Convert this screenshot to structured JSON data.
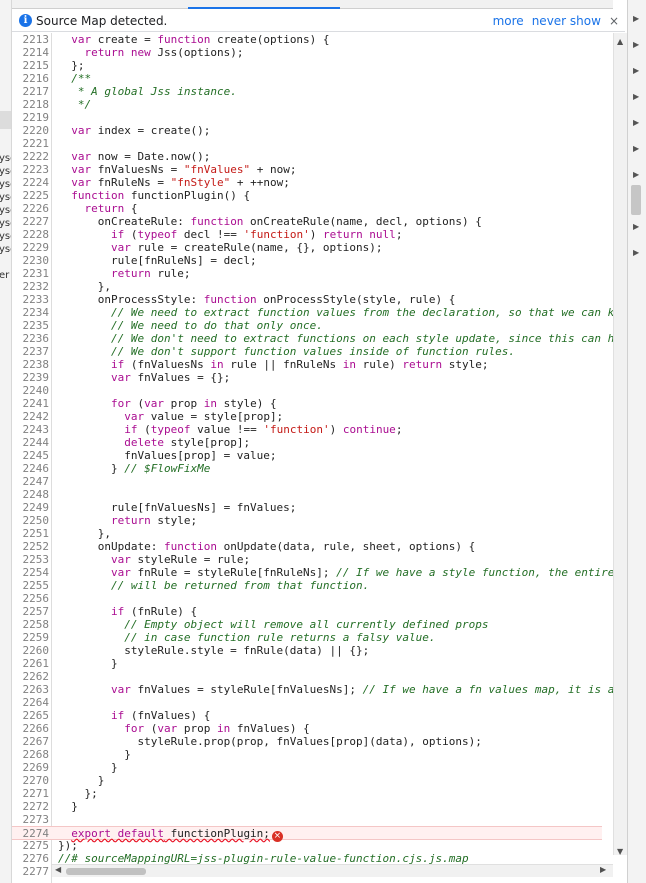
{
  "infobar": {
    "icon": "info-icon",
    "message": "Source Map detected.",
    "more_link": "more",
    "never_show_link": "never show",
    "close_glyph": "×"
  },
  "left_strip": {
    "fragments": [
      "yso",
      "yso",
      "yso",
      "yso",
      "yso",
      "yso",
      "yso",
      "yso",
      "er"
    ]
  },
  "editor": {
    "lines": [
      {
        "n": "2213",
        "html": "  <span class=\"k\">var</span> create = <span class=\"k\">function</span> create(options) {"
      },
      {
        "n": "2214",
        "html": "    <span class=\"k\">return new</span> Jss(options);"
      },
      {
        "n": "2215",
        "html": "  };"
      },
      {
        "n": "2216",
        "html": "  <span class=\"c\">/**</span>"
      },
      {
        "n": "2217",
        "html": "  <span class=\"c\"> * A global Jss instance.</span>"
      },
      {
        "n": "2218",
        "html": "  <span class=\"c\"> */</span>"
      },
      {
        "n": "2219",
        "html": ""
      },
      {
        "n": "2220",
        "html": "  <span class=\"k\">var</span> index = create();"
      },
      {
        "n": "2221",
        "html": ""
      },
      {
        "n": "2222",
        "html": "  <span class=\"k\">var</span> now = Date.now();"
      },
      {
        "n": "2223",
        "html": "  <span class=\"k\">var</span> fnValuesNs = <span class=\"s\">\"fnValues\"</span> + now;"
      },
      {
        "n": "2224",
        "html": "  <span class=\"k\">var</span> fnRuleNs = <span class=\"s\">\"fnStyle\"</span> + ++now;"
      },
      {
        "n": "2225",
        "html": "  <span class=\"k\">function</span> functionPlugin() {"
      },
      {
        "n": "2226",
        "html": "    <span class=\"k\">return</span> {"
      },
      {
        "n": "2227",
        "html": "      onCreateRule: <span class=\"k\">function</span> onCreateRule(name, decl, options) {"
      },
      {
        "n": "2228",
        "html": "        <span class=\"k\">if</span> (<span class=\"k\">typeof</span> decl !== <span class=\"s\">'function'</span>) <span class=\"k\">return null</span>;"
      },
      {
        "n": "2229",
        "html": "        <span class=\"k\">var</span> rule = createRule(name, {}, options);"
      },
      {
        "n": "2230",
        "html": "        rule[fnRuleNs] = decl;"
      },
      {
        "n": "2231",
        "html": "        <span class=\"k\">return</span> rule;"
      },
      {
        "n": "2232",
        "html": "      },"
      },
      {
        "n": "2233",
        "html": "      onProcessStyle: <span class=\"k\">function</span> onProcessStyle(style, rule) {"
      },
      {
        "n": "2234",
        "html": "        <span class=\"c\">// We need to extract function values from the declaration, so that we can k</span>"
      },
      {
        "n": "2235",
        "html": "        <span class=\"c\">// We need to do that only once.</span>"
      },
      {
        "n": "2236",
        "html": "        <span class=\"c\">// We don't need to extract functions on each style update, since this can h</span>"
      },
      {
        "n": "2237",
        "html": "        <span class=\"c\">// We don't support function values inside of function rules.</span>"
      },
      {
        "n": "2238",
        "html": "        <span class=\"k\">if</span> (fnValuesNs <span class=\"k\">in</span> rule || fnRuleNs <span class=\"k\">in</span> rule) <span class=\"k\">return</span> style;"
      },
      {
        "n": "2239",
        "html": "        <span class=\"k\">var</span> fnValues = {};"
      },
      {
        "n": "2240",
        "html": ""
      },
      {
        "n": "2241",
        "html": "        <span class=\"k\">for</span> (<span class=\"k\">var</span> prop <span class=\"k\">in</span> style) {"
      },
      {
        "n": "2242",
        "html": "          <span class=\"k\">var</span> value = style[prop];"
      },
      {
        "n": "2243",
        "html": "          <span class=\"k\">if</span> (<span class=\"k\">typeof</span> value !== <span class=\"s\">'function'</span>) <span class=\"k\">continue</span>;"
      },
      {
        "n": "2244",
        "html": "          <span class=\"k\">delete</span> style[prop];"
      },
      {
        "n": "2245",
        "html": "          fnValues[prop] = value;"
      },
      {
        "n": "2246",
        "html": "        } <span class=\"c\">// $FlowFixMe</span>"
      },
      {
        "n": "2247",
        "html": ""
      },
      {
        "n": "2248",
        "html": ""
      },
      {
        "n": "2249",
        "html": "        rule[fnValuesNs] = fnValues;"
      },
      {
        "n": "2250",
        "html": "        <span class=\"k\">return</span> style;"
      },
      {
        "n": "2251",
        "html": "      },"
      },
      {
        "n": "2252",
        "html": "      onUpdate: <span class=\"k\">function</span> onUpdate(data, rule, sheet, options) {"
      },
      {
        "n": "2253",
        "html": "        <span class=\"k\">var</span> styleRule = rule;"
      },
      {
        "n": "2254",
        "html": "        <span class=\"k\">var</span> fnRule = styleRule[fnRuleNs]; <span class=\"c\">// If we have a style function, the entire</span>"
      },
      {
        "n": "2255",
        "html": "        <span class=\"c\">// will be returned from that function.</span>"
      },
      {
        "n": "2256",
        "html": ""
      },
      {
        "n": "2257",
        "html": "        <span class=\"k\">if</span> (fnRule) {"
      },
      {
        "n": "2258",
        "html": "          <span class=\"c\">// Empty object will remove all currently defined props</span>"
      },
      {
        "n": "2259",
        "html": "          <span class=\"c\">// in case function rule returns a falsy value.</span>"
      },
      {
        "n": "2260",
        "html": "          styleRule.style = fnRule(data) || {};"
      },
      {
        "n": "2261",
        "html": "        }"
      },
      {
        "n": "2262",
        "html": ""
      },
      {
        "n": "2263",
        "html": "        <span class=\"k\">var</span> fnValues = styleRule[fnValuesNs]; <span class=\"c\">// If we have a fn values map, it is a</span>"
      },
      {
        "n": "2264",
        "html": ""
      },
      {
        "n": "2265",
        "html": "        <span class=\"k\">if</span> (fnValues) {"
      },
      {
        "n": "2266",
        "html": "          <span class=\"k\">for</span> (<span class=\"k\">var</span> prop <span class=\"k\">in</span> fnValues) {"
      },
      {
        "n": "2267",
        "html": "            styleRule.prop(prop, fnValues[prop](data), options);"
      },
      {
        "n": "2268",
        "html": "          }"
      },
      {
        "n": "2269",
        "html": "        }"
      },
      {
        "n": "2270",
        "html": "      }"
      },
      {
        "n": "2271",
        "html": "    };"
      },
      {
        "n": "2272",
        "html": "  }"
      },
      {
        "n": "2273",
        "html": ""
      },
      {
        "n": "2274",
        "html": "  <span class=\"k tk\">export default</span><span class=\"tk\"> functionPlugin;</span>",
        "error": true
      },
      {
        "n": "2275",
        "html": "});"
      },
      {
        "n": "2276",
        "html": "<span class=\"c\">//# sourceMappingURL=jss-plugin-rule-value-function.cjs.js.map</span>"
      },
      {
        "n": "2277",
        "html": ""
      }
    ]
  },
  "colors": {
    "keyword": "#aa0d91",
    "string": "#c41a16",
    "comment": "#236e25",
    "accent": "#1a73e8",
    "error": "#d93025"
  }
}
